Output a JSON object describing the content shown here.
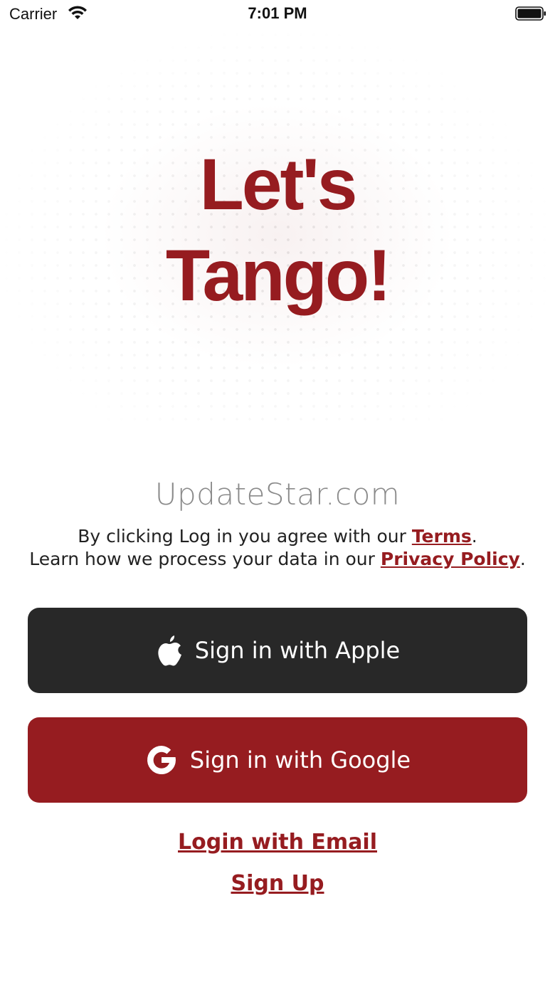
{
  "status_bar": {
    "carrier": "Carrier",
    "time": "7:01 PM"
  },
  "hero": {
    "title_line1": "Let's",
    "title_line2": "Tango!"
  },
  "watermark": "UpdateStar.com",
  "consent": {
    "line1_prefix": "By clicking Log in you agree with our ",
    "terms_link": "Terms",
    "line1_suffix": ".",
    "line2_prefix": "Learn how we process your data in our ",
    "privacy_link": "Privacy Policy",
    "line2_suffix": "."
  },
  "buttons": {
    "apple": {
      "label": "Sign in with Apple",
      "icon": "apple-icon"
    },
    "google": {
      "label": "Sign in with Google",
      "icon": "google-icon"
    }
  },
  "links": {
    "email_login": "Login with Email",
    "sign_up": "Sign Up"
  },
  "colors": {
    "brand": "#961c20",
    "apple_button": "#282828",
    "watermark": "#8a8a8a"
  }
}
